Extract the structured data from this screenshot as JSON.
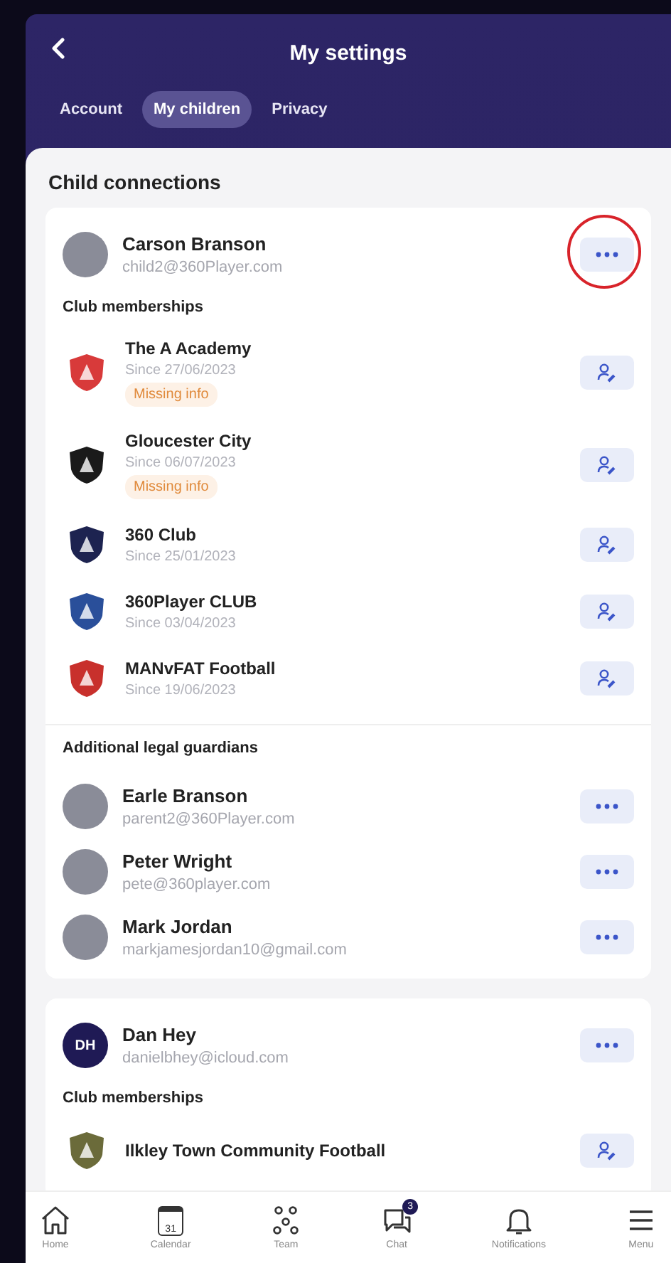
{
  "header": {
    "title": "My settings"
  },
  "tabs": [
    {
      "label": "Account",
      "selected": false
    },
    {
      "label": "My children",
      "selected": true
    },
    {
      "label": "Privacy",
      "selected": false
    }
  ],
  "section_title": "Child connections",
  "children": [
    {
      "name": "Carson Branson",
      "email": "child2@360Player.com",
      "avatar": {
        "kind": "photo"
      },
      "circled": true,
      "clubs_heading": "Club memberships",
      "clubs": [
        {
          "name": "The A Academy",
          "since": "Since 27/06/2023",
          "badge": "Missing info",
          "color": "#d83a3a"
        },
        {
          "name": "Gloucester City",
          "since": "Since 06/07/2023",
          "badge": "Missing info",
          "color": "#1a1a1a"
        },
        {
          "name": "360 Club",
          "since": "Since 25/01/2023",
          "color": "#1d2350"
        },
        {
          "name": "360Player CLUB",
          "since": "Since 03/04/2023",
          "color": "#2a4f9a"
        },
        {
          "name": "MANvFAT Football",
          "since": "Since 19/06/2023",
          "color": "#c8302c"
        }
      ],
      "guardians_heading": "Additional legal guardians",
      "guardians": [
        {
          "name": "Earle Branson",
          "email": "parent2@360Player.com",
          "avatar": {
            "kind": "photo"
          }
        },
        {
          "name": "Peter Wright",
          "email": "pete@360player.com",
          "avatar": {
            "kind": "photo"
          }
        },
        {
          "name": "Mark Jordan",
          "email": "markjamesjordan10@gmail.com",
          "avatar": {
            "kind": "photo"
          }
        }
      ]
    },
    {
      "name": "Dan Hey",
      "email": "danielbhey@icloud.com",
      "avatar": {
        "kind": "initials",
        "initials": "DH"
      },
      "circled": false,
      "clubs_heading": "Club memberships",
      "clubs": [
        {
          "name": "Ilkley Town Community Football",
          "color": "#6b6b3a"
        }
      ]
    }
  ],
  "nav": [
    {
      "kind": "home",
      "label": "Home"
    },
    {
      "kind": "calendar",
      "label": "Calendar",
      "day": "31"
    },
    {
      "kind": "team",
      "label": "Team"
    },
    {
      "kind": "chat",
      "label": "Chat",
      "badge": "3"
    },
    {
      "kind": "bell",
      "label": "Notifications"
    },
    {
      "kind": "menu",
      "label": "Menu"
    }
  ]
}
